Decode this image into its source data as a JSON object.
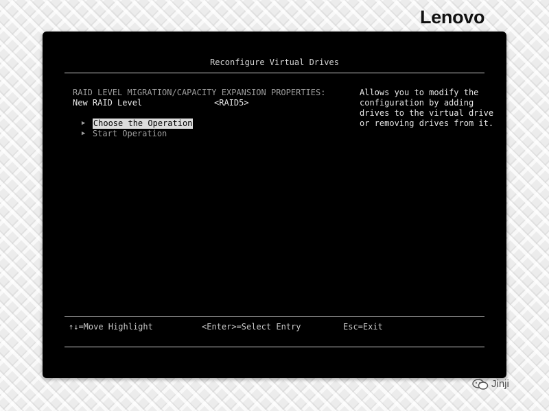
{
  "brand": {
    "logo_text": "Lenovo"
  },
  "screen": {
    "title": "Reconfigure Virtual Drives",
    "section_header": "RAID LEVEL MIGRATION/CAPACITY EXPANSION PROPERTIES:",
    "new_raid_level": {
      "label": "New RAID Level",
      "value": "<RAID5>"
    },
    "menu": [
      {
        "label": "Choose the Operation",
        "selected": true
      },
      {
        "label": "Start Operation",
        "selected": false
      }
    ],
    "help": [
      "Allows you to modify the",
      "configuration by adding",
      "drives to the virtual drive",
      "or removing drives from it."
    ]
  },
  "footer": {
    "move_hint": "↑↓=Move Highlight",
    "select_hint": "<Enter>=Select Entry",
    "exit_hint": "Esc=Exit"
  },
  "watermark": {
    "text": "Jinji",
    "icon": "wechat-icon"
  },
  "colors": {
    "console_bg": "#000000",
    "text": "#e6e6e6",
    "dim_text": "#9e9e9e",
    "highlight_bg": "#dcdcdc"
  }
}
